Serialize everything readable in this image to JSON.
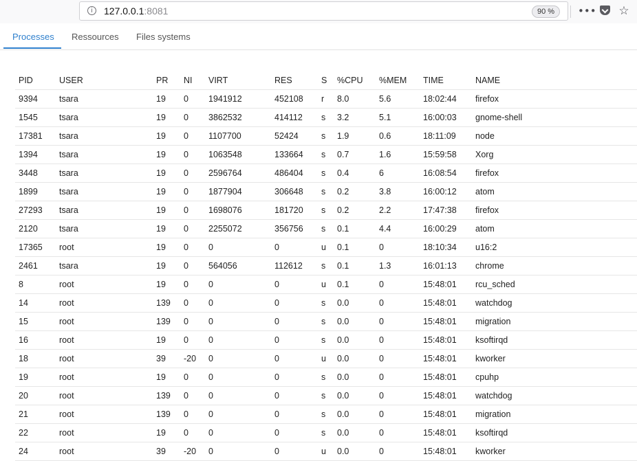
{
  "browser": {
    "url_host": "127.0.0.1",
    "url_port": ":8081",
    "zoom": "90 %"
  },
  "tabs": [
    {
      "label": "Processes",
      "active": true
    },
    {
      "label": "Ressources",
      "active": false
    },
    {
      "label": "Files systems",
      "active": false
    }
  ],
  "table": {
    "headers": [
      "PID",
      "USER",
      "PR",
      "NI",
      "VIRT",
      "RES",
      "S",
      "%CPU",
      "%MEM",
      "TIME",
      "NAME"
    ],
    "rows": [
      [
        "9394",
        "tsara",
        "19",
        "0",
        "1941912",
        "452108",
        "r",
        "8.0",
        "5.6",
        "18:02:44",
        "firefox"
      ],
      [
        "1545",
        "tsara",
        "19",
        "0",
        "3862532",
        "414112",
        "s",
        "3.2",
        "5.1",
        "16:00:03",
        "gnome-shell"
      ],
      [
        "17381",
        "tsara",
        "19",
        "0",
        "1107700",
        "52424",
        "s",
        "1.9",
        "0.6",
        "18:11:09",
        "node"
      ],
      [
        "1394",
        "tsara",
        "19",
        "0",
        "1063548",
        "133664",
        "s",
        "0.7",
        "1.6",
        "15:59:58",
        "Xorg"
      ],
      [
        "3448",
        "tsara",
        "19",
        "0",
        "2596764",
        "486404",
        "s",
        "0.4",
        "6",
        "16:08:54",
        "firefox"
      ],
      [
        "1899",
        "tsara",
        "19",
        "0",
        "1877904",
        "306648",
        "s",
        "0.2",
        "3.8",
        "16:00:12",
        "atom"
      ],
      [
        "27293",
        "tsara",
        "19",
        "0",
        "1698076",
        "181720",
        "s",
        "0.2",
        "2.2",
        "17:47:38",
        "firefox"
      ],
      [
        "2120",
        "tsara",
        "19",
        "0",
        "2255072",
        "356756",
        "s",
        "0.1",
        "4.4",
        "16:00:29",
        "atom"
      ],
      [
        "17365",
        "root",
        "19",
        "0",
        "0",
        "0",
        "u",
        "0.1",
        "0",
        "18:10:34",
        "u16:2"
      ],
      [
        "2461",
        "tsara",
        "19",
        "0",
        "564056",
        "112612",
        "s",
        "0.1",
        "1.3",
        "16:01:13",
        "chrome"
      ],
      [
        "8",
        "root",
        "19",
        "0",
        "0",
        "0",
        "u",
        "0.1",
        "0",
        "15:48:01",
        "rcu_sched"
      ],
      [
        "14",
        "root",
        "139",
        "0",
        "0",
        "0",
        "s",
        "0.0",
        "0",
        "15:48:01",
        "watchdog"
      ],
      [
        "15",
        "root",
        "139",
        "0",
        "0",
        "0",
        "s",
        "0.0",
        "0",
        "15:48:01",
        "migration"
      ],
      [
        "16",
        "root",
        "19",
        "0",
        "0",
        "0",
        "s",
        "0.0",
        "0",
        "15:48:01",
        "ksoftirqd"
      ],
      [
        "18",
        "root",
        "39",
        "-20",
        "0",
        "0",
        "u",
        "0.0",
        "0",
        "15:48:01",
        "kworker"
      ],
      [
        "19",
        "root",
        "19",
        "0",
        "0",
        "0",
        "s",
        "0.0",
        "0",
        "15:48:01",
        "cpuhp"
      ],
      [
        "20",
        "root",
        "139",
        "0",
        "0",
        "0",
        "s",
        "0.0",
        "0",
        "15:48:01",
        "watchdog"
      ],
      [
        "21",
        "root",
        "139",
        "0",
        "0",
        "0",
        "s",
        "0.0",
        "0",
        "15:48:01",
        "migration"
      ],
      [
        "22",
        "root",
        "19",
        "0",
        "0",
        "0",
        "s",
        "0.0",
        "0",
        "15:48:01",
        "ksoftirqd"
      ],
      [
        "24",
        "root",
        "39",
        "-20",
        "0",
        "0",
        "u",
        "0.0",
        "0",
        "15:48:01",
        "kworker"
      ]
    ]
  }
}
